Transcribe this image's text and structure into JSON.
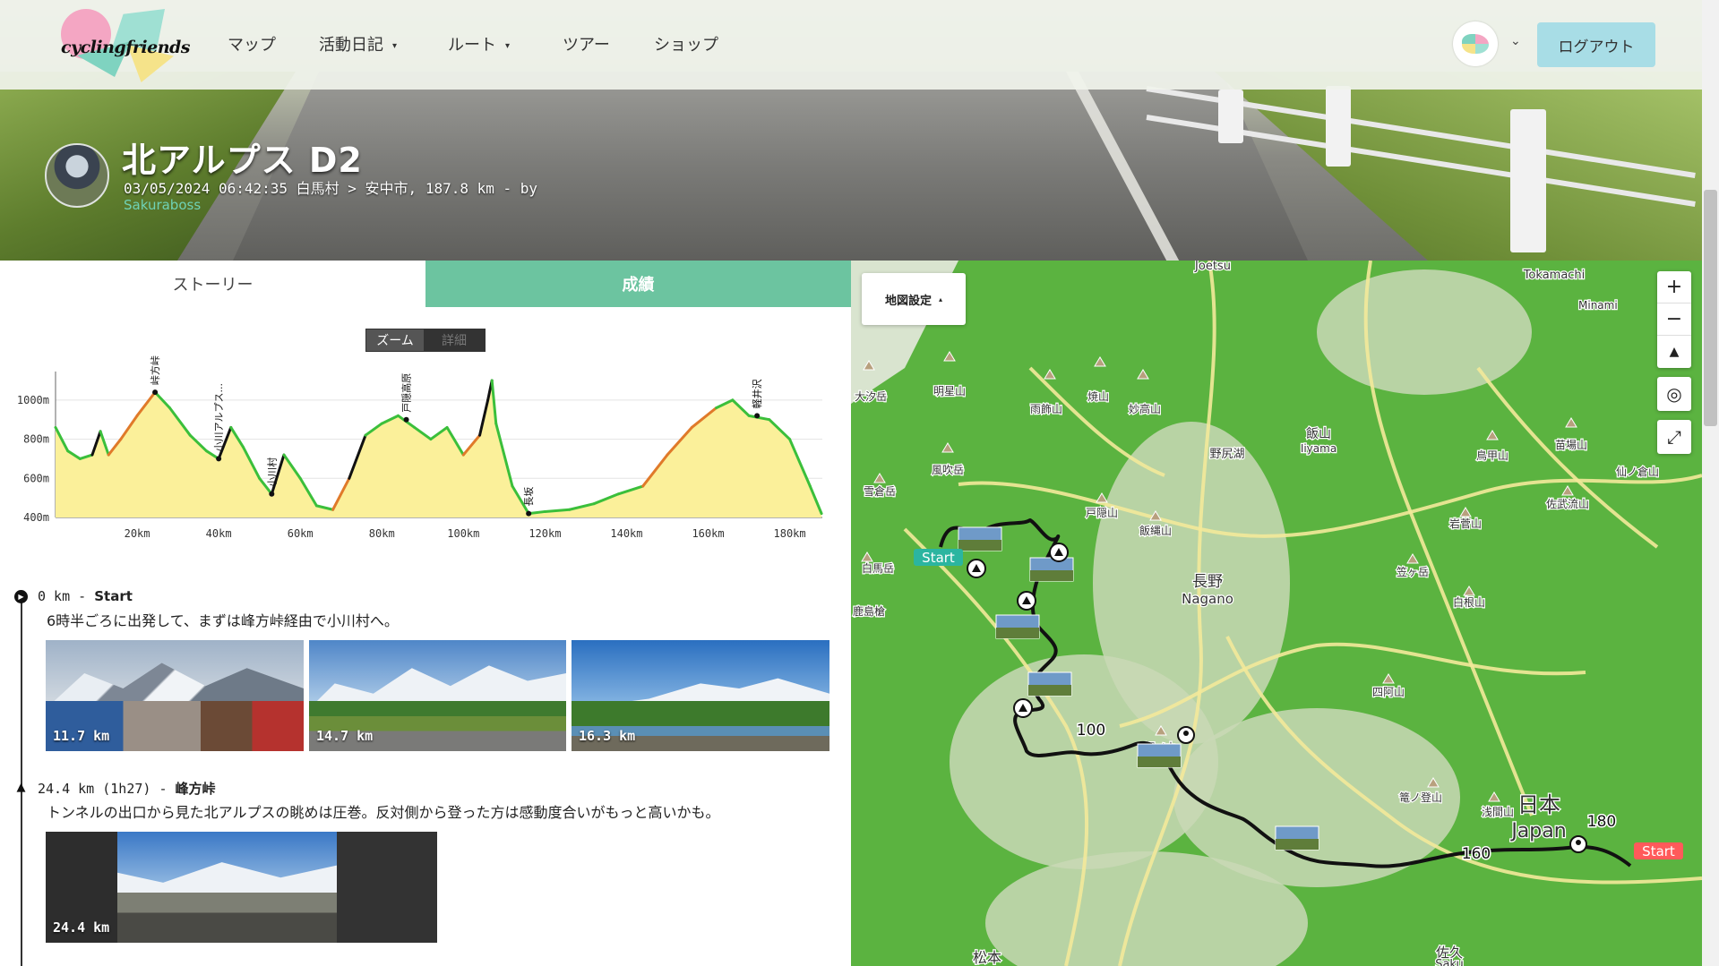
{
  "nav": {
    "logo_text": "cyclingfriends",
    "items": [
      {
        "label": "マップ",
        "caret": false
      },
      {
        "label": "活動日記",
        "caret": true
      },
      {
        "label": "ルート",
        "caret": true
      },
      {
        "label": "ツアー",
        "caret": false
      },
      {
        "label": "ショップ",
        "caret": false
      }
    ],
    "caret_glyph": "▾",
    "logout_label": "ログアウト"
  },
  "activity": {
    "title": "北アルプス D2",
    "meta": "03/05/2024 06:42:35 白馬村 > 安中市, 187.8 km - by",
    "user": "Sakuraboss"
  },
  "tabs": {
    "story": "ストーリー",
    "stats": "成績"
  },
  "chart_toggle": {
    "zoom": "ズーム",
    "detail": "詳細"
  },
  "chart_data": {
    "type": "area",
    "title": "",
    "xlabel": "",
    "ylabel": "",
    "x_unit": "km",
    "xlim": [
      0,
      188
    ],
    "ylim": [
      400,
      1100
    ],
    "yticks": [
      "400m",
      "600m",
      "800m",
      "1000m"
    ],
    "xticks": [
      "20km",
      "40km",
      "60km",
      "80km",
      "100km",
      "120km",
      "140km",
      "160km",
      "180km"
    ],
    "profile": [
      [
        0,
        860
      ],
      [
        3,
        740
      ],
      [
        6,
        700
      ],
      [
        9,
        720
      ],
      [
        11,
        840
      ],
      [
        13,
        720
      ],
      [
        16,
        800
      ],
      [
        20,
        920
      ],
      [
        24.4,
        1040
      ],
      [
        28,
        960
      ],
      [
        33,
        820
      ],
      [
        37,
        740
      ],
      [
        40,
        700
      ],
      [
        43,
        860
      ],
      [
        46,
        760
      ],
      [
        50,
        600
      ],
      [
        53,
        520
      ],
      [
        56,
        720
      ],
      [
        60,
        600
      ],
      [
        64,
        460
      ],
      [
        68,
        440
      ],
      [
        72,
        600
      ],
      [
        76,
        820
      ],
      [
        80,
        880
      ],
      [
        84,
        920
      ],
      [
        88,
        860
      ],
      [
        92,
        800
      ],
      [
        96,
        860
      ],
      [
        100,
        720
      ],
      [
        104,
        820
      ],
      [
        106,
        1000
      ],
      [
        107,
        1150
      ],
      [
        108,
        880
      ],
      [
        112,
        560
      ],
      [
        116,
        420
      ],
      [
        120,
        430
      ],
      [
        126,
        440
      ],
      [
        132,
        470
      ],
      [
        138,
        520
      ],
      [
        144,
        560
      ],
      [
        150,
        720
      ],
      [
        156,
        860
      ],
      [
        162,
        960
      ],
      [
        166,
        1000
      ],
      [
        170,
        920
      ],
      [
        175,
        900
      ],
      [
        180,
        800
      ],
      [
        185,
        560
      ],
      [
        187.8,
        420
      ]
    ],
    "peaks": [
      {
        "name": "峠方峠",
        "km": 24.4,
        "elev": 1040
      },
      {
        "name": "小川アルプス...",
        "km": 40,
        "elev": 700
      },
      {
        "name": "小川村",
        "km": 53,
        "elev": 520
      },
      {
        "name": "戸隠高原",
        "km": 86,
        "elev": 900
      },
      {
        "name": "長坂",
        "km": 116,
        "elev": 420
      },
      {
        "name": "軽井沢",
        "km": 172,
        "elev": 920
      }
    ],
    "fill": "#fbf09a",
    "line_colors": {
      "flat": "#3bbf3b",
      "climb": "#e07a2a",
      "steep": "#111111"
    }
  },
  "story": [
    {
      "head_km": "0 km - ",
      "head_name": "Start",
      "text": "6時半ごろに出発して、まずは峰方峠経由で小川村へ。",
      "photos": [
        {
          "km": "11.7 km"
        },
        {
          "km": "14.7 km"
        },
        {
          "km": "16.3 km"
        }
      ]
    },
    {
      "head_km": "24.4 km (1h27) - ",
      "head_name": "峰方峠",
      "text": "トンネルの出口から見た北アルプスの眺めは圧巻。反対側から登った方は感動度合いがもっと高いかも。",
      "photos": [
        {
          "km": "24.4 km"
        }
      ]
    }
  ],
  "map": {
    "settings_label": "地図設定",
    "settings_caret": "▴",
    "zoom_in": "+",
    "zoom_out": "−",
    "north": "▲",
    "locate": "◎",
    "fullscreen": "⤢",
    "labels": [
      {
        "text": "Joetsu"
      },
      {
        "text": "Tokamachi"
      },
      {
        "text": "Minami"
      },
      {
        "text": "明星山"
      },
      {
        "text": "大汐岳"
      },
      {
        "text": "雨飾山"
      },
      {
        "text": "焼山"
      },
      {
        "text": "妙高山"
      },
      {
        "text": "飯山"
      },
      {
        "text": "Iiyama"
      },
      {
        "text": "鳥甲山"
      },
      {
        "text": "苗場山"
      },
      {
        "text": "風吹岳"
      },
      {
        "text": "雪倉岳"
      },
      {
        "text": "野尻湖"
      },
      {
        "text": "戸隠山"
      },
      {
        "text": "飯縄山"
      },
      {
        "text": "仙ノ倉山"
      },
      {
        "text": "岩菅山"
      },
      {
        "text": "佐武流山"
      },
      {
        "text": "白馬岳"
      },
      {
        "text": "長野"
      },
      {
        "text": "Nagano"
      },
      {
        "text": "笠ヶ岳"
      },
      {
        "text": "白根山"
      },
      {
        "text": "鹿島槍"
      },
      {
        "text": "四阿山"
      },
      {
        "text": "湯ノ丸"
      },
      {
        "text": "浅間山"
      },
      {
        "text": "篭ノ登山"
      },
      {
        "text": "日本"
      },
      {
        "text": "Japan"
      },
      {
        "text": "松本"
      },
      {
        "text": "佐久"
      },
      {
        "text": "Saku"
      }
    ],
    "route_marks": [
      {
        "text": "Start"
      },
      {
        "text": "100"
      },
      {
        "text": "160"
      },
      {
        "text": "180"
      },
      {
        "text": "Start"
      }
    ],
    "colors": {
      "land": "#5bb340",
      "route": "#111111",
      "road": "#f3e99a",
      "start": "#2bb5a0",
      "finish": "#ff5a5a"
    }
  }
}
